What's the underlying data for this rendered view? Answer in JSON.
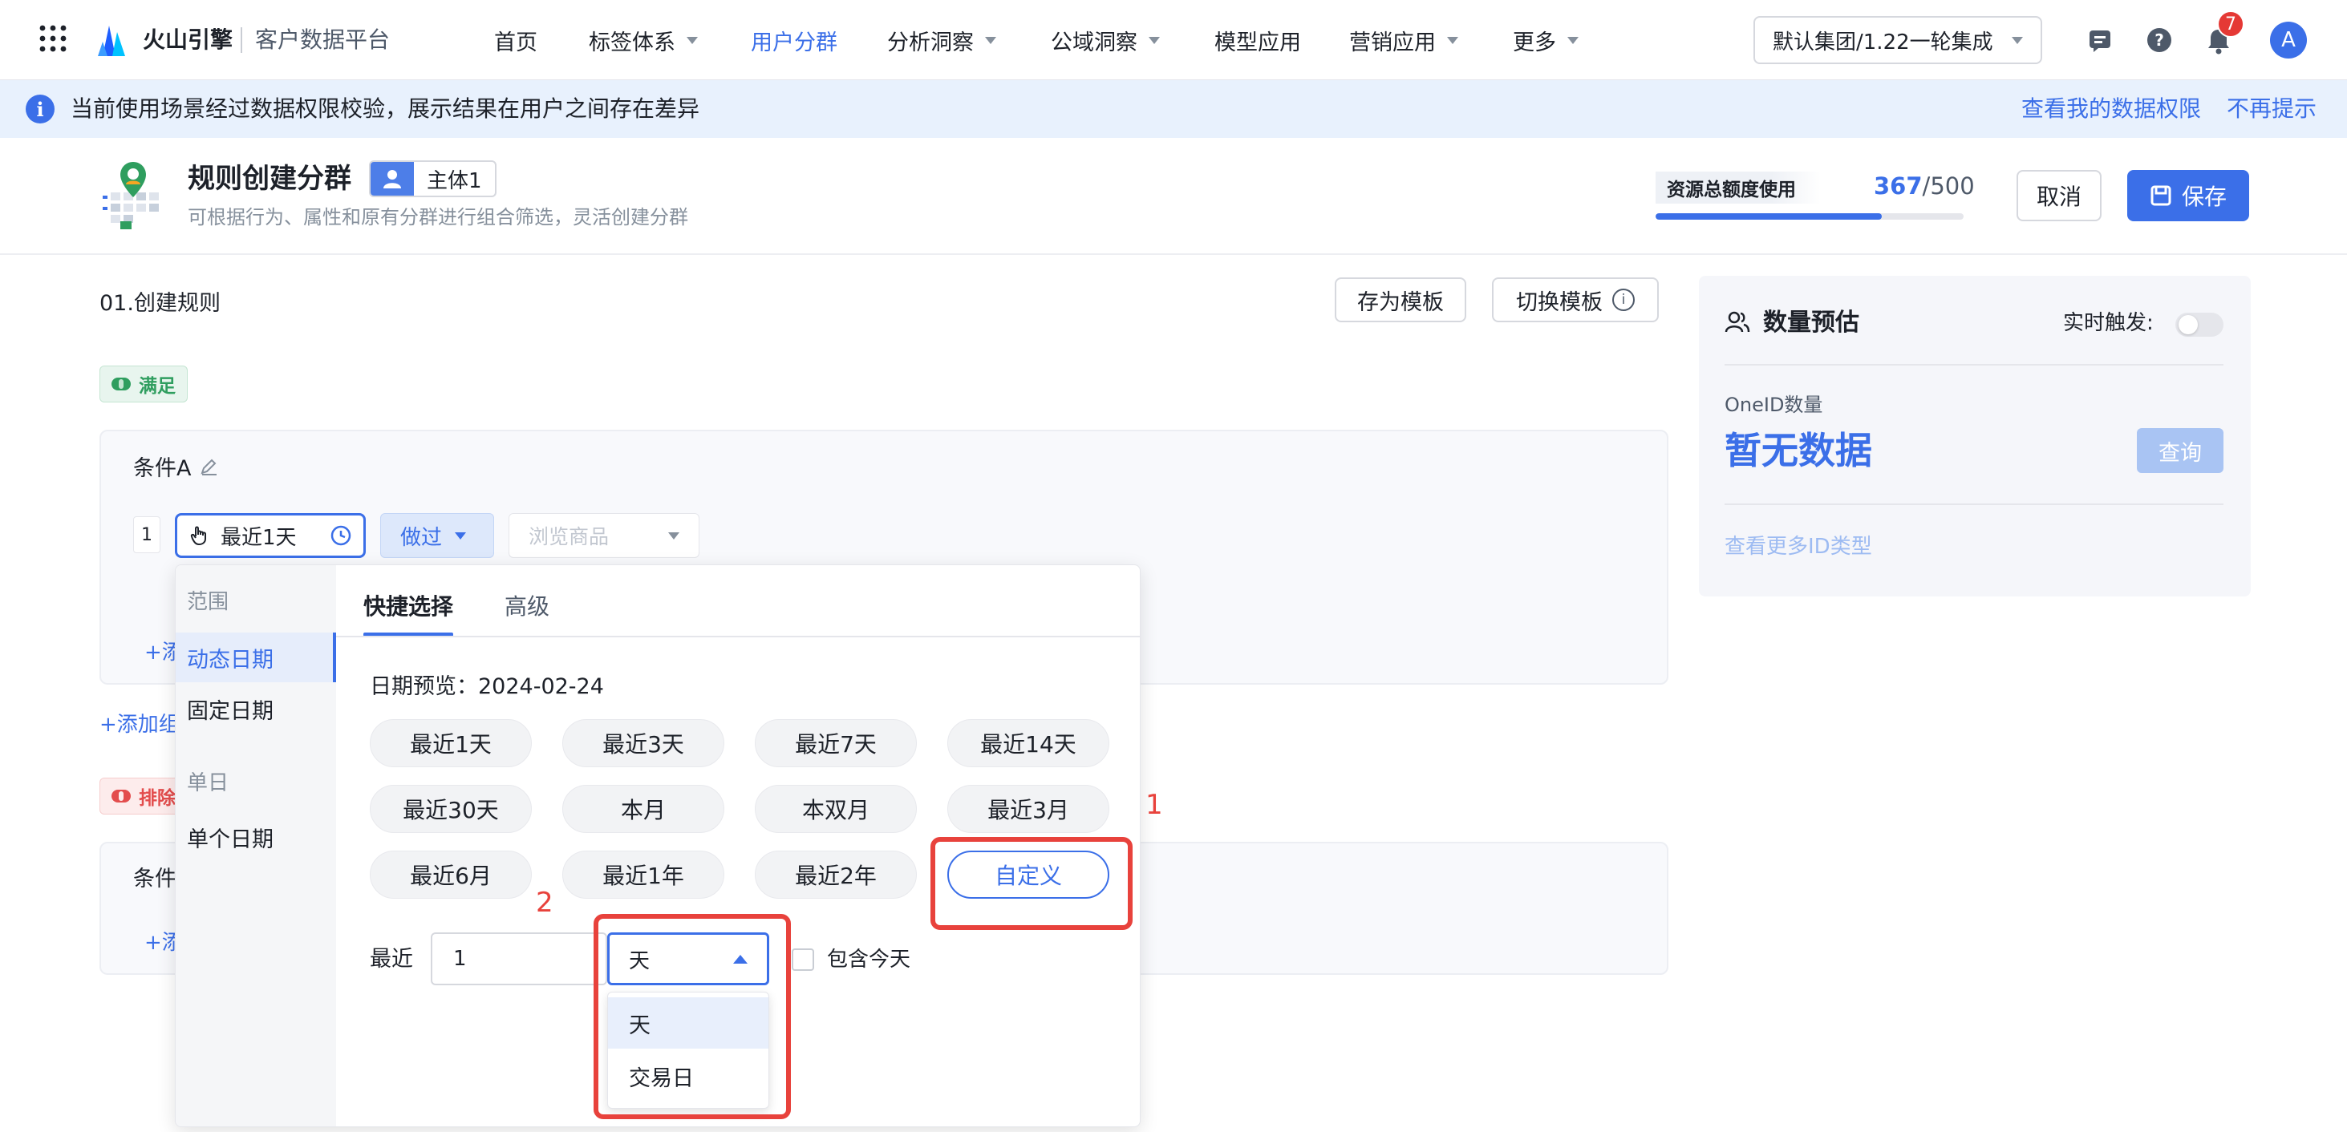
{
  "nav": {
    "brand": "火山引擎",
    "product": "客户数据平台",
    "items": [
      {
        "label": "首页",
        "dropdown": false,
        "active": false
      },
      {
        "label": "标签体系",
        "dropdown": true,
        "active": false
      },
      {
        "label": "用户分群",
        "dropdown": false,
        "active": true
      },
      {
        "label": "分析洞察",
        "dropdown": true,
        "active": false
      },
      {
        "label": "公域洞察",
        "dropdown": true,
        "active": false
      },
      {
        "label": "模型应用",
        "dropdown": false,
        "active": false
      },
      {
        "label": "营销应用",
        "dropdown": true,
        "active": false
      },
      {
        "label": "更多",
        "dropdown": true,
        "active": false
      }
    ],
    "group_select": "默认集团/1.22一轮集成",
    "notification_count": "7",
    "avatar": "A"
  },
  "banner": {
    "message": "当前使用场景经过数据权限校验，展示结果在用户之间存在差异",
    "link_permissions": "查看我的数据权限",
    "link_dismiss": "不再提示"
  },
  "header": {
    "title": "规则创建分群",
    "subject_tag": "主体1",
    "subtitle": "可根据行为、属性和原有分群进行组合筛选，灵活创建分群",
    "quota_label": "资源总额度使用",
    "quota_used": "367",
    "quota_total": "/500",
    "quota_fraction": 0.734,
    "cancel": "取消",
    "save": "保存"
  },
  "rules": {
    "section_title": "01.创建规则",
    "save_template": "存为模板",
    "switch_template": "切换模板",
    "satisfy_badge": "满足",
    "exclude_badge": "排除",
    "condition_a": "条件A",
    "condition_b": "条件",
    "row_index": "1",
    "time_chip": "最近1天",
    "did_select": "做过",
    "event_placeholder": "浏览商品",
    "add_condition_partial": "+添",
    "add_group_partial": "+添加组"
  },
  "estimate": {
    "title": "数量预估",
    "realtime_label": "实时触发:",
    "oneid_label": "OneID数量",
    "no_data": "暂无数据",
    "query": "查询",
    "more_ids": "查看更多ID类型"
  },
  "date_popup": {
    "side_group1": "范围",
    "side_dynamic": "动态日期",
    "side_fixed": "固定日期",
    "side_group2": "单日",
    "side_single": "单个日期",
    "tab_quick": "快捷选择",
    "tab_advanced": "高级",
    "preview": "日期预览：2024-02-24",
    "quick_options": [
      "最近1天",
      "最近3天",
      "最近7天",
      "最近14天",
      "最近30天",
      "本月",
      "本双月",
      "最近3月",
      "最近6月",
      "最近1年",
      "最近2年",
      "自定义"
    ],
    "recent_label": "最近",
    "recent_value": "1",
    "unit_selected": "天",
    "unit_options": [
      "天",
      "交易日"
    ],
    "include_today": "包含今天"
  },
  "annotations": {
    "mark1": "1",
    "mark2": "2"
  },
  "colors": {
    "accent": "#3b6fe8",
    "highlight": "#e8423c",
    "satisfy": "#2f9e5f",
    "exclude": "#e34d4d"
  }
}
